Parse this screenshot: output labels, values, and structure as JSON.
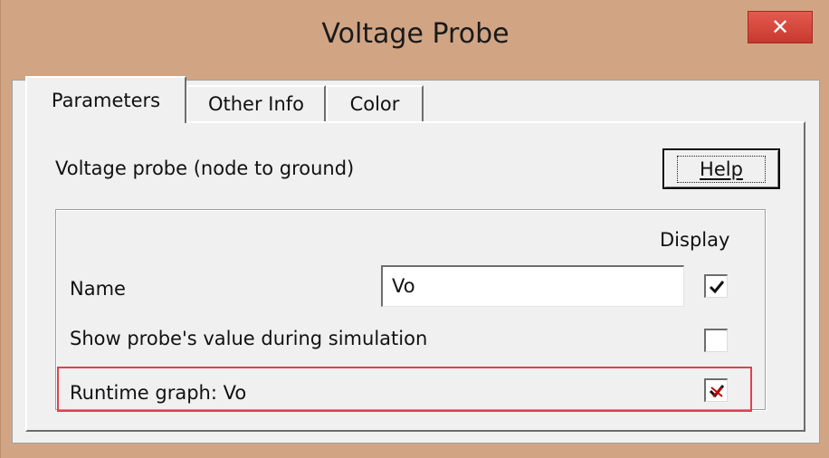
{
  "window": {
    "title": "Voltage Probe",
    "close_icon": "close-icon"
  },
  "tabs": [
    {
      "label": "Parameters",
      "active": true
    },
    {
      "label": "Other Info",
      "active": false
    },
    {
      "label": "Color",
      "active": false
    }
  ],
  "panel": {
    "description": "Voltage probe (node to ground)",
    "help_label": "Help"
  },
  "group": {
    "display_header": "Display",
    "name_label": "Name",
    "name_value": "Vo",
    "name_display_checked": true,
    "show_value_label": "Show probe's value during simulation",
    "show_value_checked": false,
    "runtime_label": "Runtime graph: Vo",
    "runtime_checked": true
  },
  "colors": {
    "titlebar_bg": "#d1a584",
    "close_button": "#c7392e",
    "highlight_border": "#e0414b",
    "runtime_check": "#cc0000"
  }
}
